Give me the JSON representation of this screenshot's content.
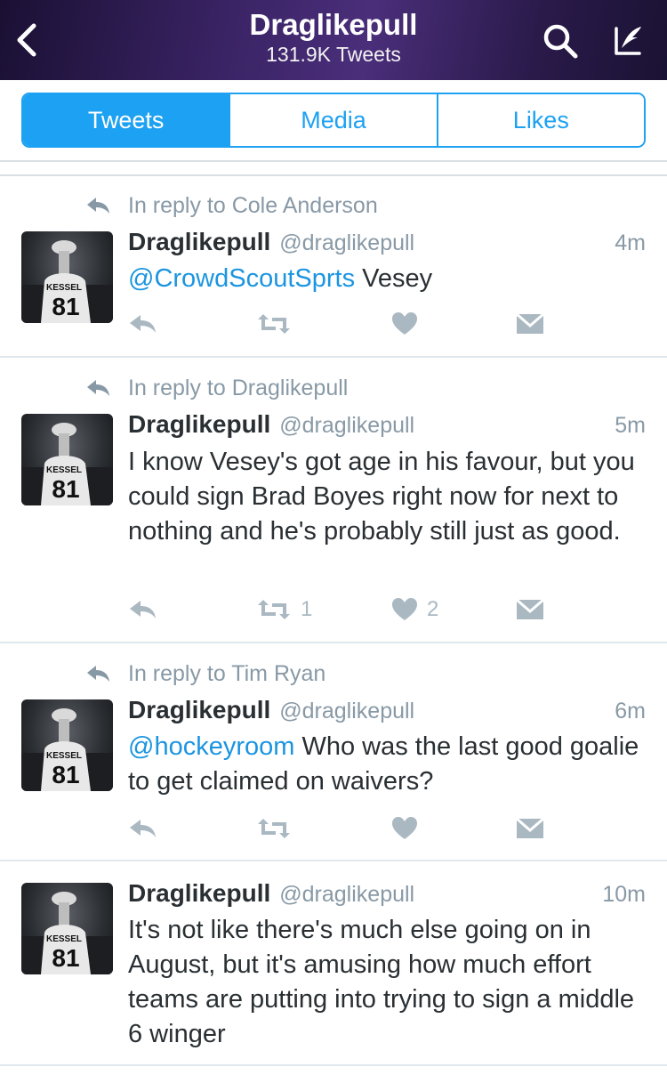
{
  "header": {
    "title": "Draglikepull",
    "subtitle": "131.9K Tweets",
    "icons": [
      "back-chevron-icon",
      "search-icon",
      "compose-icon"
    ],
    "color": "#ffffff"
  },
  "tabs": [
    {
      "label": "Tweets",
      "active": true
    },
    {
      "label": "Media",
      "active": false
    },
    {
      "label": "Likes",
      "active": false
    }
  ],
  "colors": {
    "accent": "#1da1f2",
    "mention": "#1b95e0",
    "muted": "#8899a6",
    "icon": "#aab8c2"
  },
  "tweets": [
    {
      "reply_to": "In reply to Cole Anderson",
      "name": "Draglikepull",
      "handle": "@draglikepull",
      "time": "4m",
      "mention": "@CrowdScoutSprts",
      "text": " Vesey",
      "retweets": "",
      "likes": ""
    },
    {
      "reply_to": "In reply to Draglikepull",
      "name": "Draglikepull",
      "handle": "@draglikepull",
      "time": "5m",
      "mention": "",
      "text": "I know Vesey's got age in his favour, but you could sign Brad Boyes right now for next to nothing and he's probably still just as good.",
      "retweets": "1",
      "likes": "2"
    },
    {
      "reply_to": "In reply to Tim Ryan",
      "name": "Draglikepull",
      "handle": "@draglikepull",
      "time": "6m",
      "mention": "@hockeyroom",
      "text": " Who was the last good goalie to get claimed on waivers?",
      "retweets": "",
      "likes": ""
    },
    {
      "reply_to": "",
      "name": "Draglikepull",
      "handle": "@draglikepull",
      "time": "10m",
      "mention": "",
      "text": "It's not like there's much else going on in August, but it's amusing how much effort teams are putting into trying to sign a middle 6 winger",
      "retweets": "",
      "likes": ""
    }
  ]
}
